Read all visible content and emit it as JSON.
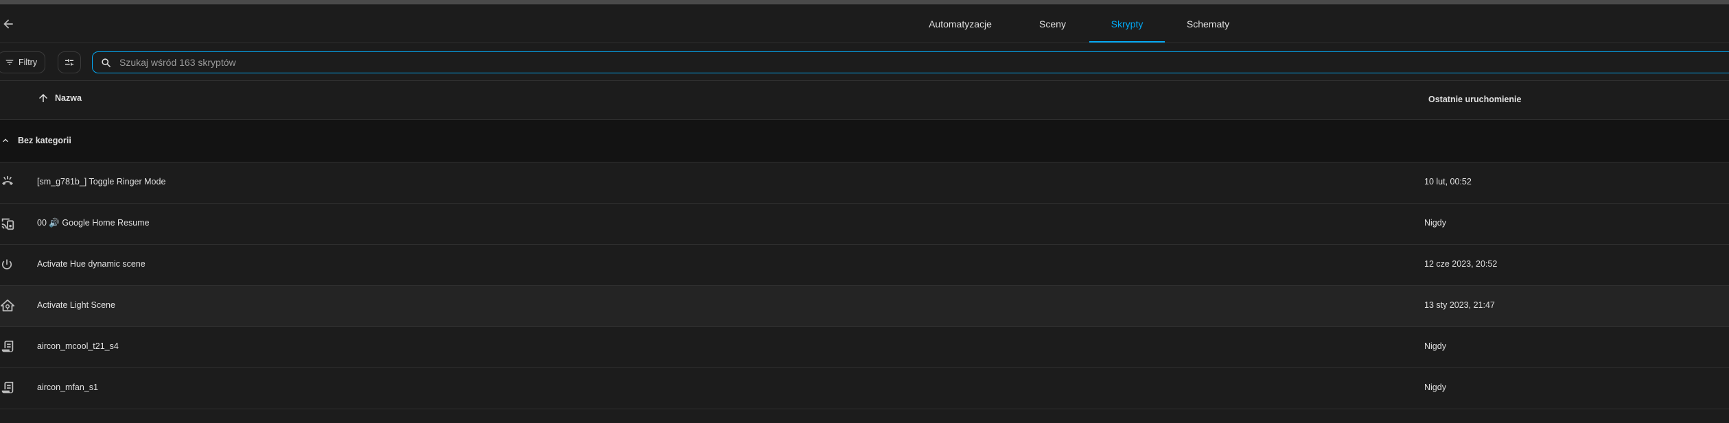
{
  "header": {
    "tabs": [
      {
        "label": "Automatyzacje",
        "active": false
      },
      {
        "label": "Sceny",
        "active": false
      },
      {
        "label": "Skrypty",
        "active": true
      },
      {
        "label": "Schematy",
        "active": false
      }
    ]
  },
  "toolbar": {
    "filter_label": "Filtry",
    "search_placeholder": "Szukaj wśród 163 skryptów",
    "search_value": ""
  },
  "table": {
    "columns": {
      "name": "Nazwa",
      "last_run": "Ostatnie uruchomienie"
    },
    "group": {
      "label": "Bez kategorii"
    },
    "rows": [
      {
        "icon": "phone-ring-icon",
        "name": "[sm_g781b_] Toggle Ringer Mode",
        "last_run": "10 lut, 00:52"
      },
      {
        "icon": "cast-speaker-icon",
        "name": "00 🔊 Google Home Resume",
        "last_run": "Nigdy"
      },
      {
        "icon": "power-icon",
        "name": "Activate Hue dynamic scene",
        "last_run": "12 cze 2023, 20:52"
      },
      {
        "icon": "home-lightbulb-icon",
        "name": "Activate Light Scene",
        "last_run": "13 sty 2023, 21:47"
      },
      {
        "icon": "script-text-icon",
        "name": "aircon_mcool_t21_s4",
        "last_run": "Nigdy"
      },
      {
        "icon": "script-text-icon",
        "name": "aircon_mfan_s1",
        "last_run": "Nigdy"
      }
    ]
  },
  "colors": {
    "accent": "#03a9f4",
    "background": "#1c1c1c",
    "group_background": "#131313",
    "text": "#e1e1e1"
  }
}
